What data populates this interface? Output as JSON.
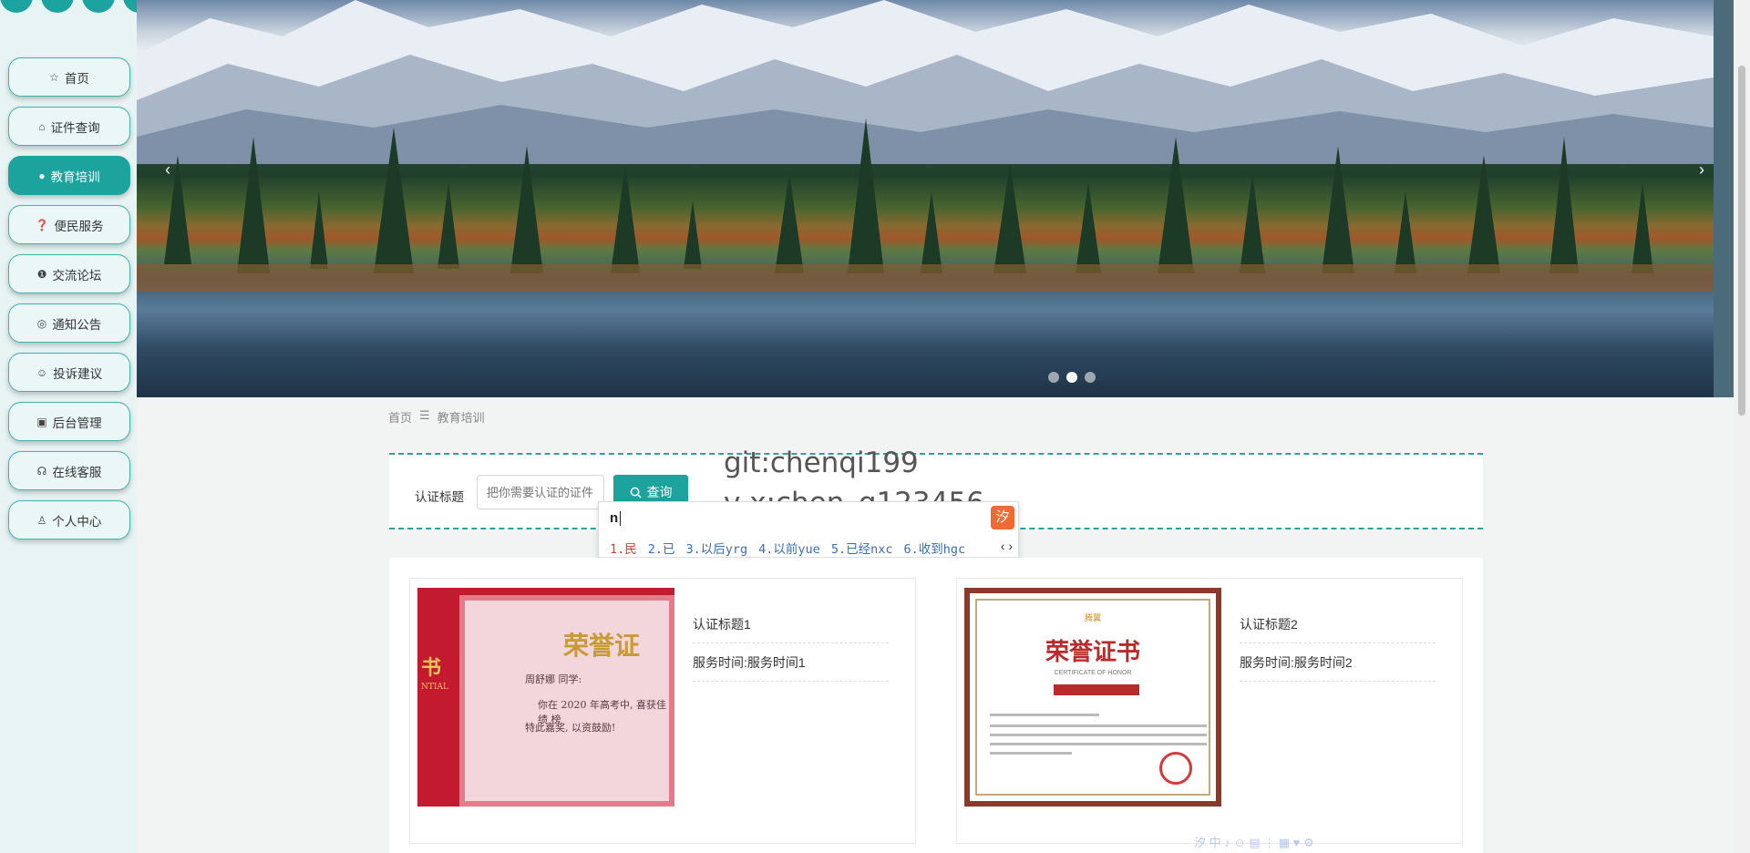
{
  "sidebar": {
    "items": [
      {
        "label": "首页",
        "icon": "star-icon",
        "glyph": "☆",
        "active": false
      },
      {
        "label": "证件查询",
        "icon": "bag-icon",
        "glyph": "⌂",
        "active": false
      },
      {
        "label": "教育培训",
        "icon": "info-circle-icon",
        "glyph": "●",
        "active": true
      },
      {
        "label": "便民服务",
        "icon": "question-circle-icon",
        "glyph": "❓",
        "active": false
      },
      {
        "label": "交流论坛",
        "icon": "info-circle-icon",
        "glyph": "❶",
        "active": false
      },
      {
        "label": "通知公告",
        "icon": "globe-icon",
        "glyph": "◎",
        "active": false
      },
      {
        "label": "投诉建议",
        "icon": "smile-icon",
        "glyph": "☺",
        "active": false
      },
      {
        "label": "后台管理",
        "icon": "briefcase-icon",
        "glyph": "▣",
        "active": false
      },
      {
        "label": "在线客服",
        "icon": "headset-icon",
        "glyph": "☊",
        "active": false
      },
      {
        "label": "个人中心",
        "icon": "user-icon",
        "glyph": "♙",
        "active": false
      }
    ]
  },
  "banner": {
    "prev": "‹",
    "next": "›",
    "slide_count": 3,
    "active_slide": 2
  },
  "breadcrumb": {
    "home": "首页",
    "separator": "☰",
    "current": "教育培训"
  },
  "search": {
    "label": "认证标题",
    "placeholder": "把你需要认证的证件",
    "button": "查询"
  },
  "watermark": {
    "line1": "git:chenqi199",
    "line2": "v x:chen_q123456"
  },
  "ime": {
    "input": "n",
    "candidates": [
      "1.民",
      "2.已",
      "3.以后yrg",
      "4.以前yue",
      "5.已经nxc",
      "6.收到hgc"
    ],
    "arrows": "‹ ›",
    "logo": "汐",
    "toolbar": "汐 中 ♪ ☺ ▤ ⋮ ▦ ♥ ⚙"
  },
  "cards": [
    {
      "title": "认证标题1",
      "time": "服务时间:服务时间1",
      "cert_title": "荣誉证",
      "cert_side": "书",
      "cert_name": "周舒娜 同学:",
      "cert_line1": "你在 2020 年高考中, 喜获佳绩 榜",
      "cert_line2": "特此嘉奖, 以资鼓励!",
      "cert_side_text": "NTIAL"
    },
    {
      "title": "认证标题2",
      "time": "服务时间:服务时间2",
      "cert_title": "荣誉证书",
      "cert_sub": "CERTIFICATE OF HONOR",
      "cert_brand": "腾翼"
    }
  ],
  "colors": {
    "accent": "#1ca39e",
    "nav_bg": "#eaf7f6",
    "ime_first": "#d43c2f",
    "ime_other": "#3a6fb0"
  }
}
